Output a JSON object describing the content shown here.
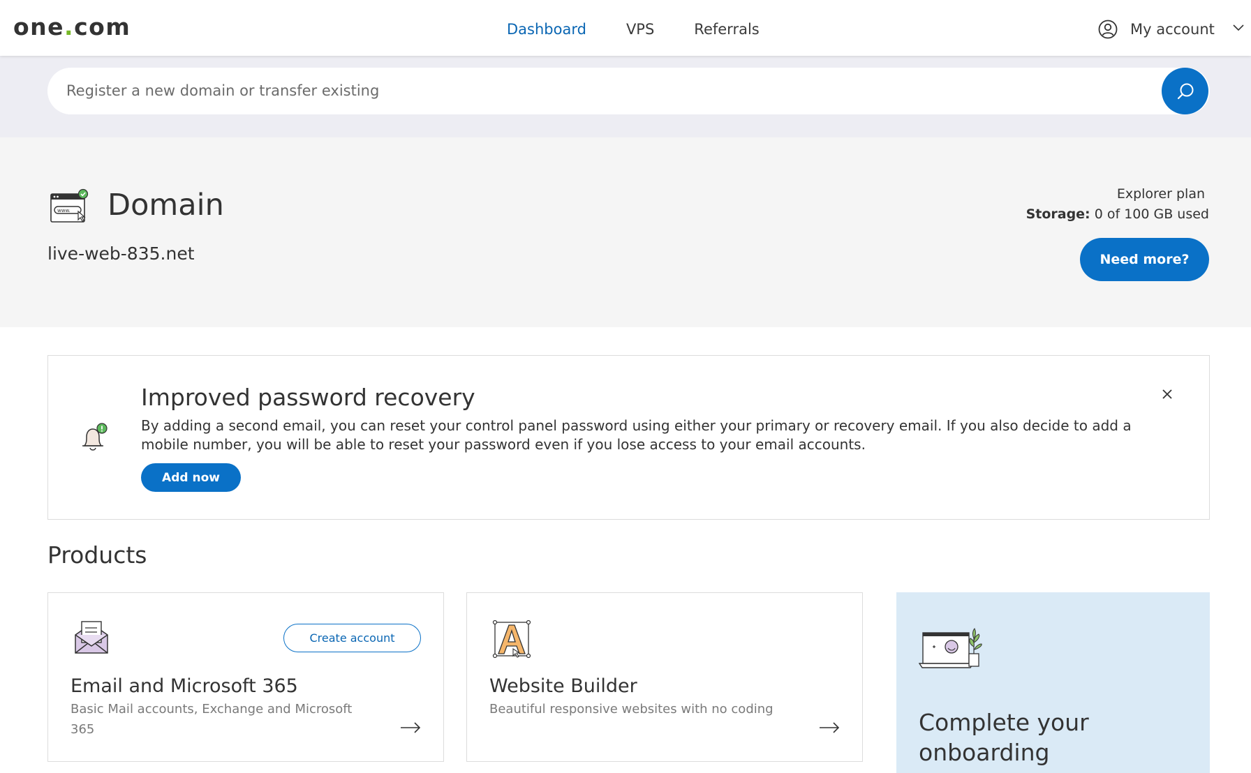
{
  "header": {
    "logo_left": "one",
    "logo_dot": ".",
    "logo_right": "com",
    "nav": [
      {
        "label": "Dashboard",
        "active": true
      },
      {
        "label": "VPS",
        "active": false
      },
      {
        "label": "Referrals",
        "active": false
      }
    ],
    "account_label": "My account"
  },
  "search": {
    "placeholder": "Register a new domain or transfer existing"
  },
  "domain": {
    "title": "Domain",
    "name": "live-web-835.net",
    "plan": "Explorer plan",
    "storage_label": "Storage:",
    "storage_value": "0 of 100 GB used",
    "need_more_label": "Need more?"
  },
  "notice": {
    "title": "Improved password recovery",
    "body": "By adding a second email, you can reset your control panel password using either your primary or recovery email. If you also decide to add a mobile number, you will be able to reset your password even if you lose access to your email accounts.",
    "button_label": "Add now"
  },
  "products": {
    "title": "Products",
    "cards": [
      {
        "title": "Email and Microsoft 365",
        "description": "Basic Mail accounts, Exchange and Microsoft 365",
        "action_label": "Create account"
      },
      {
        "title": "Website Builder",
        "description": "Beautiful responsive websites with no coding"
      }
    ],
    "onboarding_title": "Complete your onboarding"
  },
  "colors": {
    "brand_blue": "#0a71c7",
    "active_nav": "#0a66b3",
    "logo_dot": "#77b828",
    "onboarding_bg": "#daeaf6"
  },
  "icons": [
    "user-circle-icon",
    "chevron-down-icon",
    "search-icon",
    "domain-browser-icon",
    "bell-icon",
    "close-icon",
    "envelope-icon",
    "letter-a-icon",
    "laptop-plant-icon",
    "arrow-right-icon"
  ]
}
